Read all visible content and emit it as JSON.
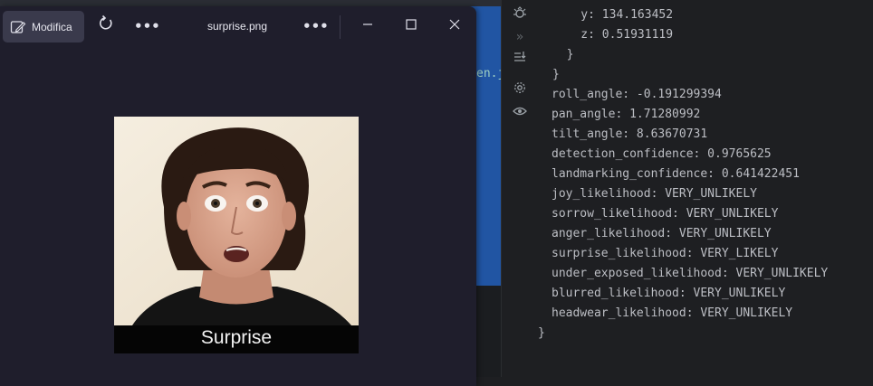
{
  "viewer": {
    "edit_label": "Modifica",
    "file_name": "surprise.png",
    "image_caption": "Surprise"
  },
  "ide": {
    "fragment": "en.j"
  },
  "console_lines": [
    "    y: 134.163452",
    "    z: 0.51931119",
    "  }",
    "}",
    "roll_angle: -0.191299394",
    "pan_angle: 1.71280992",
    "tilt_angle: 8.63670731",
    "detection_confidence: 0.9765625",
    "landmarking_confidence: 0.641422451",
    "joy_likelihood: VERY_UNLIKELY",
    "sorrow_likelihood: VERY_UNLIKELY",
    "anger_likelihood: VERY_UNLIKELY",
    "surprise_likelihood: VERY_LIKELY",
    "under_exposed_likelihood: VERY_UNLIKELY",
    "blurred_likelihood: VERY_UNLIKELY",
    "headwear_likelihood: VERY_UNLIKELY",
    "}"
  ],
  "rail_icons": [
    "bug-icon",
    "double-chevron-icon",
    "scroll-down-icon",
    "gear-icon",
    "eye-icon"
  ]
}
